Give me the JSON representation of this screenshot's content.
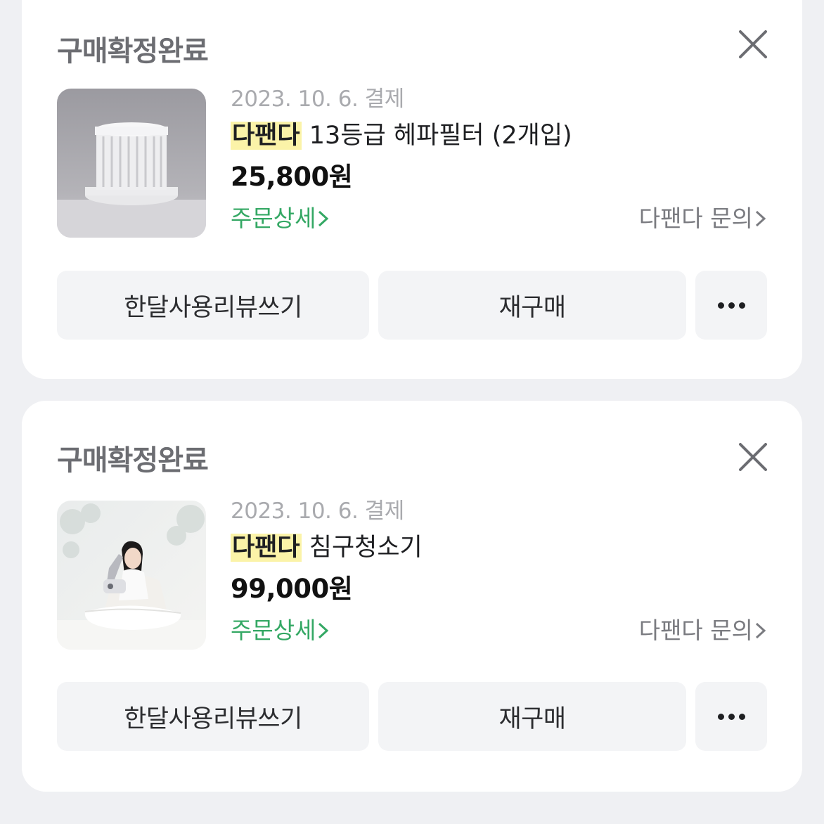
{
  "orders": [
    {
      "status": "구매확정완료",
      "date": "2023. 10. 6. 결제",
      "brand": "다팬다",
      "product": "13등급 헤파필터 (2개입)",
      "price": "25,800원",
      "detail_link": "주문상세",
      "inquiry_link": "다팬다 문의",
      "buttons": {
        "review": "한달사용리뷰쓰기",
        "rebuy": "재구매"
      },
      "image": "hepa-filter-photo"
    },
    {
      "status": "구매확정완료",
      "date": "2023. 10. 6. 결제",
      "brand": "다팬다",
      "product": "침구청소기",
      "price": "99,000원",
      "detail_link": "주문상세",
      "inquiry_link": "다팬다 문의",
      "buttons": {
        "review": "한달사용리뷰쓰기",
        "rebuy": "재구매"
      },
      "image": "bedding-vacuum-photo"
    }
  ],
  "icons": {
    "close": "close-icon",
    "more": "more-dots-icon",
    "chevron": "chevron-right-icon"
  },
  "colors": {
    "link_green": "#34a864",
    "brand_highlight": "#fbf3a8",
    "background": "#eff0f3"
  }
}
